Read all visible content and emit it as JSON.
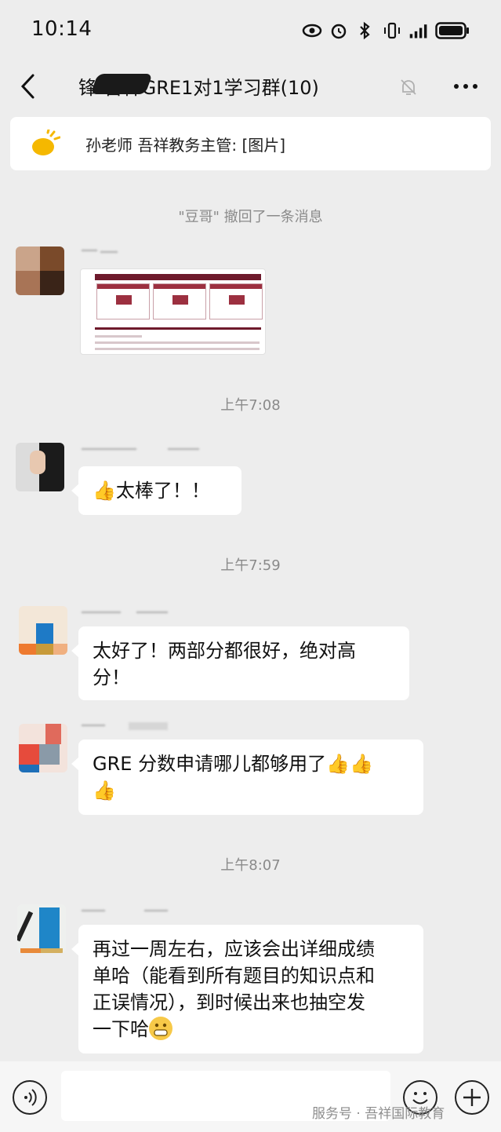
{
  "status": {
    "time": "10:14"
  },
  "header": {
    "title": "锋-吾祥GRE1对1学习群(10)"
  },
  "notice": {
    "text": "孙老师 吾祥教务主管: [图片]"
  },
  "system_message": "\"豆哥\" 撤回了一条消息",
  "timestamps": [
    "上午7:08",
    "上午7:59",
    "上午8:07"
  ],
  "messages": [
    {
      "text": "太棒了！！",
      "emoji_before": "👍"
    },
    {
      "line1": "太好了！两部分都很好，绝对高",
      "line2": "分！"
    },
    {
      "line1": "GRE 分数申请哪儿都够用了",
      "emoji_line1": "👍👍",
      "emoji_line2": "👍"
    },
    {
      "line1": "再过一周左右，应该会出详细成绩",
      "line2": "单哈（能看到所有题目的知识点和",
      "line3": "正误情况），到时候出来也抽空发",
      "line4": "一下哈"
    }
  ],
  "watermark": "服务号 · 吾祥国际教育",
  "icons": [
    "back-arrow-icon",
    "mute-bell-icon",
    "more-icon",
    "voice-icon",
    "emoji-icon",
    "plus-icon"
  ],
  "colors": {
    "background": "#ededed",
    "bubble": "#ffffff",
    "accent": "#6e1a2c"
  }
}
